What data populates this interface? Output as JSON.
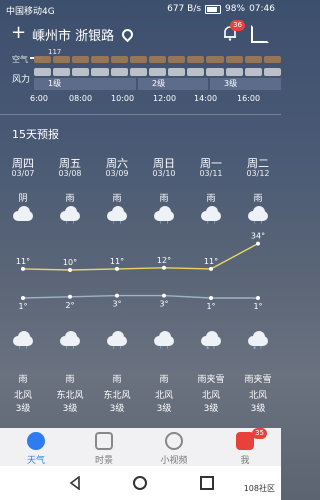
{
  "status": {
    "carrier": "中国移动4G",
    "speed": "677 B/s",
    "battery": "98%",
    "time": "07:46"
  },
  "header": {
    "location": "嵊州市 浙银路",
    "notif_count": "36"
  },
  "hourly": {
    "aq_label": "空气",
    "aq_value": "117",
    "wind_label": "风力",
    "levels": [
      "1级",
      "2级",
      "3级"
    ],
    "times": [
      "6:00",
      "08:00",
      "10:00",
      "12:00",
      "14:00",
      "16:00"
    ]
  },
  "forecast": {
    "title": "15天预报",
    "days": [
      {
        "weekday": "周四",
        "date": "03/07",
        "day_weather": "阴",
        "high": "11°",
        "low": "1°",
        "night_weather": "雨",
        "wind": "北风",
        "level": "3级"
      },
      {
        "weekday": "周五",
        "date": "03/08",
        "day_weather": "雨",
        "high": "10°",
        "low": "2°",
        "night_weather": "雨",
        "wind": "东北风",
        "level": "3级"
      },
      {
        "weekday": "周六",
        "date": "03/09",
        "day_weather": "雨",
        "high": "11°",
        "low": "3°",
        "night_weather": "雨",
        "wind": "东北风",
        "level": "3级"
      },
      {
        "weekday": "周日",
        "date": "03/10",
        "day_weather": "雨",
        "high": "12°",
        "low": "3°",
        "night_weather": "雨",
        "wind": "北风",
        "level": "3级"
      },
      {
        "weekday": "周一",
        "date": "03/11",
        "day_weather": "雨",
        "high": "11°",
        "low": "1°",
        "night_weather": "雨夹雪",
        "wind": "北风",
        "level": "3级"
      },
      {
        "weekday": "周二",
        "date": "03/12",
        "day_weather": "雨",
        "high": "34°",
        "low": "1°",
        "night_weather": "雨夹雪",
        "wind": "北风",
        "level": "3级"
      }
    ]
  },
  "tabs": {
    "weather": "天气",
    "scene": "时景",
    "video": "小视频",
    "me": "我",
    "me_badge": "35"
  },
  "watermark": "108社区",
  "colors": {
    "accent": "#2e7df0",
    "badge": "#e8413c",
    "high_line": "#e8d36a",
    "low_line": "#9fb3c8"
  }
}
